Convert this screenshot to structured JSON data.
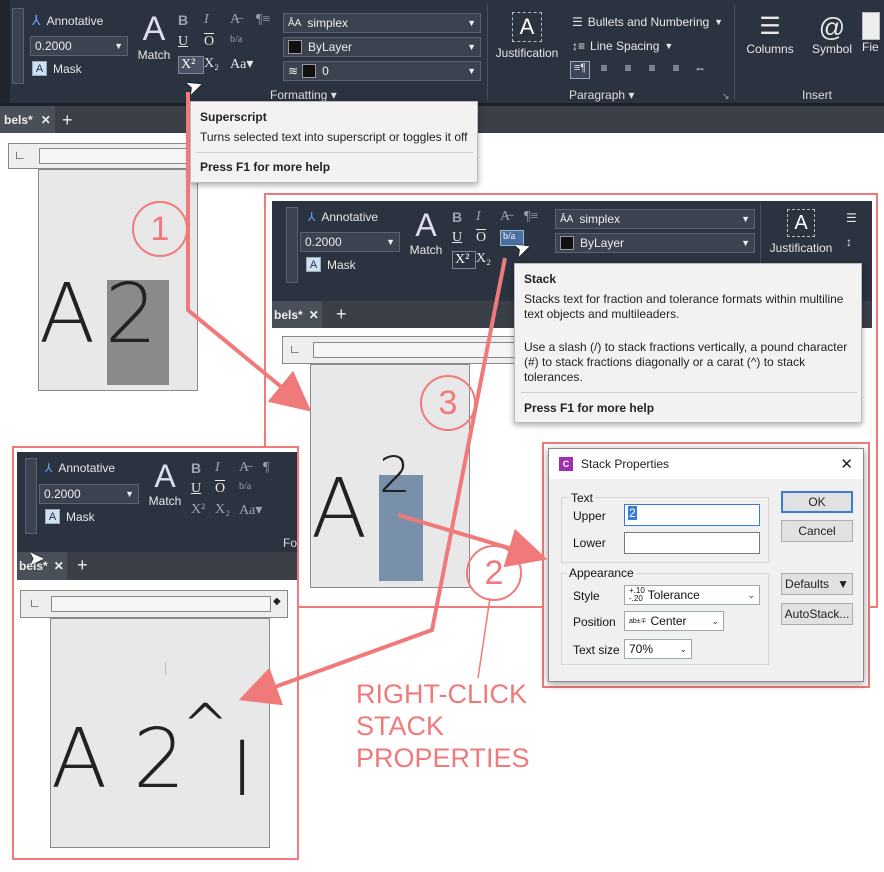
{
  "ribbon_top": {
    "annotative": "Annotative",
    "height_value": "0.2000",
    "mask": "Mask",
    "match": "Match",
    "font": "simplex",
    "color": "ByLayer",
    "oblique": "0",
    "formatting": "Formatting",
    "justification": "Justification",
    "bullets": "Bullets and Numbering",
    "line_spacing": "Line Spacing",
    "paragraph": "Paragraph",
    "columns": "Columns",
    "symbol": "Symbol",
    "field": "Fie",
    "insert": "Insert",
    "tab_label": "bels*"
  },
  "tooltip_superscript": {
    "title": "Superscript",
    "desc": "Turns selected text into superscript or toggles it off",
    "help": "Press F1 for more help"
  },
  "ribbon_mid": {
    "annotative": "Annotative",
    "height_value": "0.2000",
    "mask": "Mask",
    "match": "Match",
    "font": "simplex",
    "color": "ByLayer",
    "justification": "Justification",
    "tab_label": "bels*"
  },
  "tooltip_stack": {
    "title": "Stack",
    "desc1": "Stacks text for fraction and tolerance formats within multiline text objects and multileaders.",
    "desc2": "Use a slash (/) to stack fractions vertically, a pound character (#) to stack fractions diagonally or a carat (^) to stack tolerances.",
    "help": "Press F1 for more help"
  },
  "ribbon_bottom": {
    "annotative": "Annotative",
    "height_value": "0.2000",
    "mask": "Mask",
    "match": "Match",
    "fo": "Fo",
    "tab_label": "bels*"
  },
  "stack_dialog": {
    "title": "Stack Properties",
    "text_group": "Text",
    "upper_label": "Upper",
    "upper_value": "2",
    "lower_label": "Lower",
    "lower_value": "",
    "appearance_group": "Appearance",
    "style_label": "Style",
    "style_value": "Tolerance",
    "position_label": "Position",
    "position_value": "Center",
    "textsize_label": "Text size",
    "textsize_value": "70%",
    "ok": "OK",
    "cancel": "Cancel",
    "defaults": "Defaults",
    "autostack": "AutoStack..."
  },
  "editors": {
    "top_text_a": "A",
    "top_text_2": "2",
    "mid_text_a": "A",
    "mid_text_2": "2",
    "bot_text": "A 2",
    "bot_caret": "^",
    "bot_cursor": "I"
  },
  "callouts": {
    "one": "1",
    "two": "2",
    "three": "3",
    "label": "RIGHT-CLICK\nSTACK\nPROPERTIES"
  }
}
